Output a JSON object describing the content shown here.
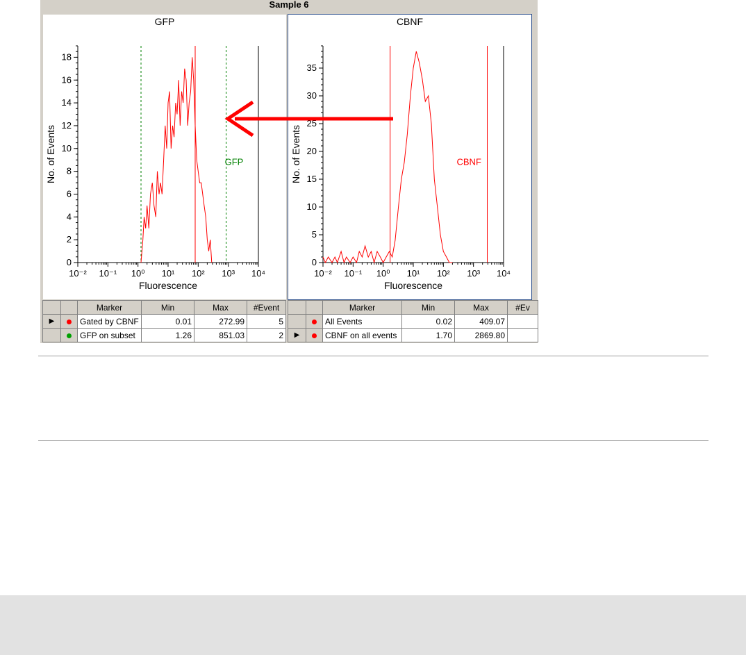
{
  "window": {
    "title": "Sample 6"
  },
  "chart_data": [
    {
      "type": "line",
      "title": "GFP",
      "xlabel": "Fluorescence",
      "ylabel": "No. of Events",
      "x_scale": "log",
      "xlim": [
        0.01,
        10000
      ],
      "ylim": [
        0,
        19
      ],
      "xtick_labels": [
        "10⁻²",
        "10⁻¹",
        "10⁰",
        "10¹",
        "10²",
        "10³",
        "10⁴"
      ],
      "ytick_labels": [
        "0",
        "2",
        "4",
        "6",
        "8",
        "10",
        "12",
        "14",
        "16",
        "18"
      ],
      "series": [
        {
          "color": "#ff0000",
          "x": [
            1.26,
            1.45,
            1.6,
            1.8,
            2.0,
            2.3,
            2.6,
            3.0,
            3.4,
            3.9,
            4.4,
            5.0,
            5.6,
            6.3,
            7.1,
            8.0,
            9.0,
            10.0,
            11.2,
            12.6,
            14.1,
            15.8,
            17.8,
            20.0,
            22.4,
            25.1,
            28.2,
            31.6,
            35.5,
            39.8,
            44.7,
            50.1,
            56.2,
            63.1,
            70.8,
            79.4,
            89.1,
            100,
            112,
            126,
            141,
            158,
            178,
            200,
            224,
            251,
            282
          ],
          "y": [
            0,
            2,
            4,
            3,
            5,
            3,
            6,
            7,
            5,
            4,
            8,
            6,
            7,
            6,
            9,
            12,
            10,
            14,
            15,
            10,
            12,
            11,
            14,
            13,
            16,
            12,
            15,
            14,
            17,
            16,
            12,
            14,
            15,
            18,
            16,
            12,
            9,
            8,
            7,
            7,
            6,
            5,
            4,
            2,
            1,
            2,
            0
          ]
        }
      ],
      "markers": [
        {
          "label": "GFP",
          "range": [
            1.26,
            851.03
          ],
          "color": "#008000",
          "style": "dashed"
        }
      ],
      "gate_line": {
        "x": 79.4,
        "color": "#ff0000"
      }
    },
    {
      "type": "line",
      "title": "CBNF",
      "xlabel": "Fluorescence",
      "ylabel": "No. of Events",
      "x_scale": "log",
      "xlim": [
        0.01,
        10000
      ],
      "ylim": [
        0,
        39
      ],
      "xtick_labels": [
        "10⁻²",
        "10⁻¹",
        "10⁰",
        "10¹",
        "10²",
        "10³",
        "10⁴"
      ],
      "ytick_labels": [
        "0",
        "5",
        "10",
        "15",
        "20",
        "25",
        "30",
        "35"
      ],
      "series": [
        {
          "color": "#ff0000",
          "x": [
            0.01,
            0.012,
            0.015,
            0.02,
            0.025,
            0.03,
            0.04,
            0.05,
            0.06,
            0.08,
            0.1,
            0.13,
            0.16,
            0.2,
            0.25,
            0.32,
            0.4,
            0.5,
            0.63,
            0.8,
            1.0,
            1.26,
            1.6,
            2.0,
            2.5,
            3.2,
            4.0,
            5.0,
            6.3,
            8.0,
            10.0,
            12.6,
            15.8,
            20.0,
            25.1,
            31.6,
            39.8,
            50.1,
            63.1,
            79.4,
            100,
            126,
            158,
            200
          ],
          "y": [
            1,
            0,
            1,
            0,
            1,
            0,
            2,
            0,
            1,
            0,
            1,
            0,
            2,
            1,
            3,
            1,
            2,
            0,
            2,
            1,
            0,
            1,
            2,
            1,
            4,
            10,
            15,
            18,
            23,
            30,
            35,
            38,
            36,
            33,
            29,
            30,
            25,
            15,
            10,
            5,
            2,
            1,
            0,
            0
          ]
        }
      ],
      "markers": [
        {
          "label": "CBNF",
          "range": [
            1.7,
            2869.8
          ],
          "color": "#ff0000",
          "style": "solid"
        }
      ]
    }
  ],
  "tables": [
    {
      "headers": [
        "Marker",
        "Min",
        "Max",
        "#Event"
      ],
      "rows": [
        {
          "pointer": true,
          "color": "#ff0000",
          "marker": "Gated by CBNF",
          "min": "0.01",
          "max": "272.99",
          "events": "5"
        },
        {
          "pointer": false,
          "color": "#00a000",
          "marker": "GFP on subset",
          "min": "1.26",
          "max": "851.03",
          "events": "2"
        }
      ]
    },
    {
      "headers": [
        "Marker",
        "Min",
        "Max",
        "#Ev"
      ],
      "rows": [
        {
          "pointer": false,
          "color": "#ff0000",
          "marker": "All Events",
          "min": "0.02",
          "max": "409.07",
          "events": ""
        },
        {
          "pointer": true,
          "color": "#ff0000",
          "marker": "CBNF on all events",
          "min": "1.70",
          "max": "2869.80",
          "events": ""
        }
      ]
    }
  ],
  "annotation_arrow_color": "#ff0000",
  "pointer_glyph": "▶"
}
